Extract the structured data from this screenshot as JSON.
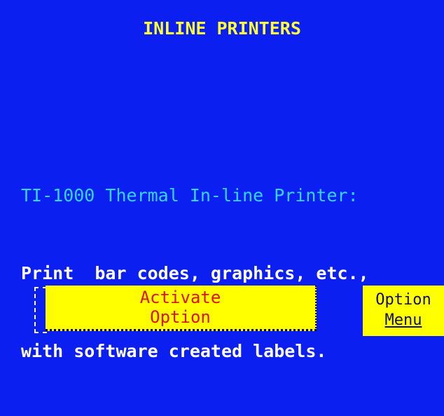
{
  "screen": {
    "title": "INLINE PRINTERS",
    "description": {
      "heading": "TI-1000 Thermal In-line Printer:",
      "line1": "Print  bar codes, graphics, etc.,",
      "line2": "with software created labels."
    }
  },
  "buttons": {
    "activate": {
      "line1": "Activate",
      "line2": "Option"
    },
    "option_menu": {
      "line1": "Option",
      "line2": "Menu"
    }
  },
  "colors": {
    "background": "#0b1ff0",
    "title": "#ffff33",
    "heading": "#33d6ff",
    "body_text": "#ffffff",
    "button_bg": "#ffff00",
    "activate_text": "#e01010",
    "option_text": "#101060"
  }
}
